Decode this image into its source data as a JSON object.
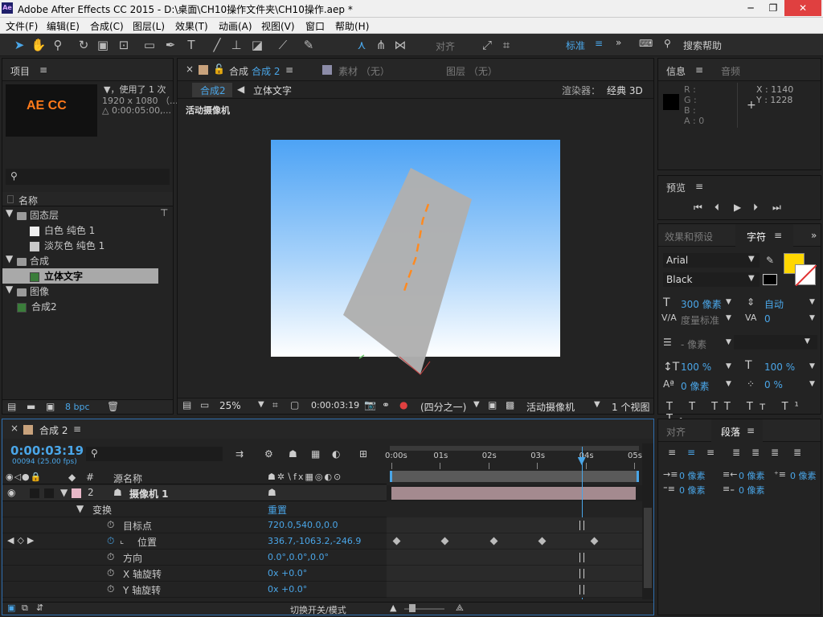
{
  "window": {
    "title": "Adobe After Effects CC 2015 - D:\\桌面\\CH10操作文件夹\\CH10操作.aep *",
    "logo": "Ae"
  },
  "menu": [
    "文件(F)",
    "编辑(E)",
    "合成(C)",
    "图层(L)",
    "效果(T)",
    "动画(A)",
    "视图(V)",
    "窗口",
    "帮助(H)"
  ],
  "toolbar": {
    "align_label": "对齐",
    "workspace": "标准",
    "search_help": "搜索帮助"
  },
  "project": {
    "tab": "项目",
    "thumb_text": "AE CC",
    "info_line1": "▼，使用了 1 次",
    "info_line2": "1920 x 1080 （...",
    "info_line3": "△ 0:00:05:00,...",
    "column_name": "名称",
    "items": [
      {
        "label": "固态层",
        "type": "folder",
        "level": 0
      },
      {
        "label": "白色 纯色 1",
        "type": "solid",
        "level": 1
      },
      {
        "label": "淡灰色 纯色 1",
        "type": "solid",
        "level": 1
      },
      {
        "label": "合成",
        "type": "folder",
        "level": 0
      },
      {
        "label": "立体文字",
        "type": "comp",
        "level": 1,
        "selected": true
      },
      {
        "label": "图像",
        "type": "folder",
        "level": 0
      },
      {
        "label": "合成2",
        "type": "comp",
        "level": 0
      }
    ],
    "bpc": "8 bpc"
  },
  "composition": {
    "tab_prefix": "合成",
    "tab_name": "合成 2",
    "footage_tab": "素材 （无）",
    "layer_tab": "图层 （无）",
    "breadcrumb_active": "合成2",
    "breadcrumb_next": "立体文字",
    "renderer_label": "渲染器：",
    "renderer_value": "经典 3D",
    "view_label": "活动摄像机",
    "zoom": "25%",
    "timecode": "0:00:03:19",
    "resolution": "(四分之一)",
    "camera_select": "活动摄像机",
    "views_select": "1 个视图"
  },
  "info": {
    "tab": "信息",
    "tab2": "音频",
    "r": "R :",
    "g": "G :",
    "b": "B :",
    "a": "A : 0",
    "x": "X : 1140",
    "y": "Y : 1228"
  },
  "preview": {
    "tab": "预览"
  },
  "character": {
    "tab_effects": "效果和预设",
    "tab": "字符",
    "font": "Arial",
    "style": "Black",
    "size": "300 像素",
    "leading": "自动",
    "kerning": "度量标准",
    "tracking": "0",
    "stroke_width": "- 像素",
    "vscale": "100 %",
    "hscale": "100 %",
    "baseline": "0 像素",
    "tsume": "0 %",
    "fill_color": "#ffd700"
  },
  "paragraph": {
    "tab_align": "对齐",
    "tab": "段落",
    "indent_left": "0 像素",
    "indent_right": "0 像素",
    "first_line": "0 像素",
    "space_before": "0 像素",
    "space_after": "0 像素"
  },
  "timeline": {
    "tab": "合成 2",
    "timecode": "0:00:03:19",
    "frame_info": "00094 (25.00 fps)",
    "col_hash": "#",
    "col_source": "源名称",
    "ruler": [
      "0:00s",
      "01s",
      "02s",
      "03s",
      "04s",
      "05s"
    ],
    "playhead": 0.764,
    "layer": {
      "index": "2",
      "name": "摄像机 1"
    },
    "transform_label": "变换",
    "reset_label": "重置",
    "props": [
      {
        "name": "目标点",
        "value": "720.0,540.0,0.0",
        "keyed": false
      },
      {
        "name": "位置",
        "value": "336.7,-1063.2,-246.9",
        "keyed": true
      },
      {
        "name": "方向",
        "value": "0.0°,0.0°,0.0°",
        "keyed": false
      },
      {
        "name": "X 轴旋转",
        "value": "0x +0.0°",
        "keyed": false
      },
      {
        "name": "Y 轴旋转",
        "value": "0x +0.0°",
        "keyed": false
      }
    ],
    "keyframe_times": [
      0.0,
      0.2,
      0.4,
      0.6,
      0.814
    ],
    "switch_mode": "切换开关/模式"
  }
}
